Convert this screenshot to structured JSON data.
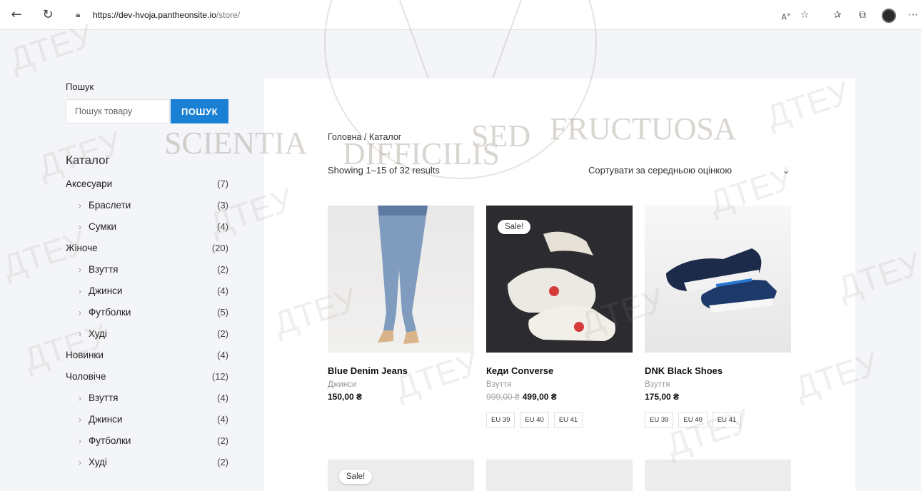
{
  "browser": {
    "back_icon": "arrow-left-icon",
    "refresh_icon": "refresh-icon",
    "url_host": "https://dev-hvoja.pantheonsite.io",
    "url_path": "/store/"
  },
  "sidebar": {
    "search_label": "Пошук",
    "search_placeholder": "Пошук товару",
    "search_button": "ПОШУК",
    "catalog_title": "Каталог",
    "categories": [
      {
        "label": "Аксесуари",
        "count": "(7)",
        "sub": false
      },
      {
        "label": "Браслети",
        "count": "(3)",
        "sub": true
      },
      {
        "label": "Сумки",
        "count": "(4)",
        "sub": true
      },
      {
        "label": "Жіноче",
        "count": "(20)",
        "sub": false
      },
      {
        "label": "Взуття",
        "count": "(2)",
        "sub": true
      },
      {
        "label": "Джинси",
        "count": "(4)",
        "sub": true
      },
      {
        "label": "Футболки",
        "count": "(5)",
        "sub": true
      },
      {
        "label": "Худі",
        "count": "(2)",
        "sub": true
      },
      {
        "label": "Новинки",
        "count": "(4)",
        "sub": false
      },
      {
        "label": "Чоловіче",
        "count": "(12)",
        "sub": false
      },
      {
        "label": "Взуття",
        "count": "(4)",
        "sub": true
      },
      {
        "label": "Джинси",
        "count": "(4)",
        "sub": true
      },
      {
        "label": "Футболки",
        "count": "(2)",
        "sub": true
      },
      {
        "label": "Худі",
        "count": "(2)",
        "sub": true
      }
    ]
  },
  "shop": {
    "breadcrumb": "Головна / Каталог",
    "results": "Showing 1–15 of 32 results",
    "sort_label": "Сортувати за середньою оцінкою",
    "sale_badge": "Sale!",
    "products": [
      {
        "name": "Blue Denim Jeans",
        "category": "Джинси",
        "old_price": "",
        "price": "150,00 ₴",
        "sizes": []
      },
      {
        "name": "Кеди Converse",
        "category": "Взуття",
        "old_price": "999,00 ₴",
        "price": "499,00 ₴",
        "sizes": [
          "EU 39",
          "EU 40",
          "EU 41"
        ]
      },
      {
        "name": "DNK Black Shoes",
        "category": "Взуття",
        "old_price": "",
        "price": "175,00 ₴",
        "sizes": [
          "EU 39",
          "EU 40",
          "EU 41"
        ]
      }
    ]
  },
  "watermark": {
    "motto": [
      "SCIENTIA",
      "DIFFICILIS",
      "SED",
      "FRUCTUOSA"
    ],
    "text": "ДТЕУ"
  },
  "colors": {
    "accent": "#1a80d4",
    "panel": "#ffffff",
    "background": "#f4f5f8"
  }
}
